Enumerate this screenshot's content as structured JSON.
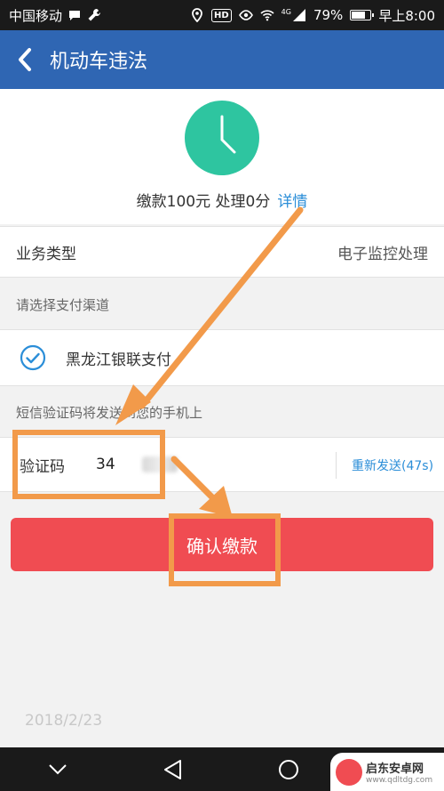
{
  "status": {
    "carrier": "中国移动",
    "hd": "HD",
    "signal_tag": "4G",
    "battery": "79%",
    "battery_level": 0.79,
    "time": "早上8:00"
  },
  "header": {
    "title": "机动车违法"
  },
  "summary": {
    "text": "缴款100元 处理0分",
    "detail_link": "详情"
  },
  "business": {
    "label": "业务类型",
    "value": "电子监控处理"
  },
  "payment": {
    "section_label": "请选择支付渠道",
    "channel": "黑龙江银联支付"
  },
  "sms": {
    "section_label": "短信验证码将发送到您的手机上",
    "code_label": "验证码",
    "code_value": "34",
    "resend": "重新发送(47s)"
  },
  "confirm_button": "确认缴款",
  "date": "2018/2/23",
  "watermark": {
    "name": "启东安卓网",
    "url": "www.qdltdg.com"
  },
  "colors": {
    "app_bar": "#2f66b3",
    "accent_teal": "#2ec5a0",
    "link_blue": "#2b8ed8",
    "confirm_red": "#f04c52",
    "annotation_orange": "#f29a4a"
  }
}
